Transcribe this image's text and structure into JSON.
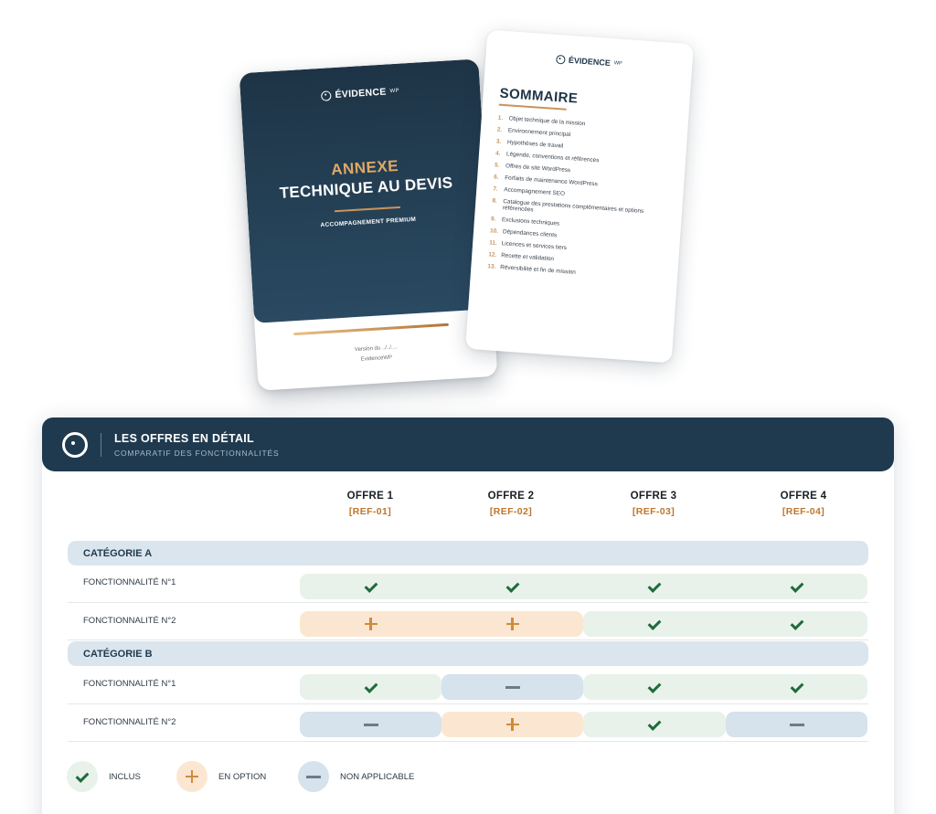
{
  "colors": {
    "navy": "#1f3a4f",
    "accent_gold": "#c8945a",
    "ref_orange": "#c0752c",
    "included_bg": "#e8f2ea",
    "option_bg": "#fbe7d1",
    "na_bg": "#d6e2ec",
    "category_bg": "#dbe5ee"
  },
  "cover": {
    "logo": "ÉVIDENCE",
    "logo_suffix": "WP",
    "title_line1": "ANNEXE",
    "title_line2": "TECHNIQUE AU DEVIS",
    "subtitle": "ACCOMPAGNEMENT PREMIUM",
    "version": "Version du ../../....",
    "brand": "EvidenceWP"
  },
  "summary": {
    "logo": "ÉVIDENCE",
    "logo_suffix": "WP",
    "title": "SOMMAIRE",
    "items": [
      {
        "num": "1.",
        "text": "Objet technique de la mission"
      },
      {
        "num": "2.",
        "text": "Environnement principal"
      },
      {
        "num": "3.",
        "text": "Hypothèses de travail"
      },
      {
        "num": "4.",
        "text": "Légende, conventions et références"
      },
      {
        "num": "5.",
        "text": "Offres de site WordPress"
      },
      {
        "num": "6.",
        "text": "Forfaits de maintenance WordPress"
      },
      {
        "num": "7.",
        "text": "Accompagnement SEO"
      },
      {
        "num": "8.",
        "text": "Catalogue des prestations complémentaires et options référencées"
      },
      {
        "num": "9.",
        "text": "Exclusions techniques"
      },
      {
        "num": "10.",
        "text": "Dépendances clients"
      },
      {
        "num": "11.",
        "text": "Licences et services tiers"
      },
      {
        "num": "12.",
        "text": "Recette et validation"
      },
      {
        "num": "13.",
        "text": "Réversibilité et fin de mission"
      }
    ]
  },
  "panel": {
    "title": "LES OFFRES EN DÉTAIL",
    "subtitle": "COMPARATIF DES FONCTIONNALITÉS",
    "offers": [
      {
        "name": "OFFRE 1",
        "ref": "[REF-01]"
      },
      {
        "name": "OFFRE 2",
        "ref": "[REF-02]"
      },
      {
        "name": "OFFRE 3",
        "ref": "[REF-03]"
      },
      {
        "name": "OFFRE 4",
        "ref": "[REF-04]"
      }
    ],
    "categories": [
      {
        "label": "CATÉGORIE A",
        "features": [
          {
            "label": "FONCTIONNALITÉ N°1",
            "values": [
              "included",
              "included",
              "included",
              "included"
            ]
          },
          {
            "label": "FONCTIONNALITÉ N°2",
            "values": [
              "option",
              "option",
              "included",
              "included"
            ]
          }
        ]
      },
      {
        "label": "CATÉGORIE B",
        "features": [
          {
            "label": "FONCTIONNALITÉ N°1",
            "values": [
              "included",
              "na",
              "included",
              "included"
            ]
          },
          {
            "label": "FONCTIONNALITÉ N°2",
            "values": [
              "na",
              "option",
              "included",
              "na"
            ]
          }
        ]
      }
    ],
    "legend": [
      {
        "key": "included",
        "icon": "check-icon",
        "label": "INCLUS"
      },
      {
        "key": "option",
        "icon": "plus-icon",
        "label": "EN OPTION"
      },
      {
        "key": "na",
        "icon": "minus-icon",
        "label": "NON APPLICABLE"
      }
    ]
  }
}
